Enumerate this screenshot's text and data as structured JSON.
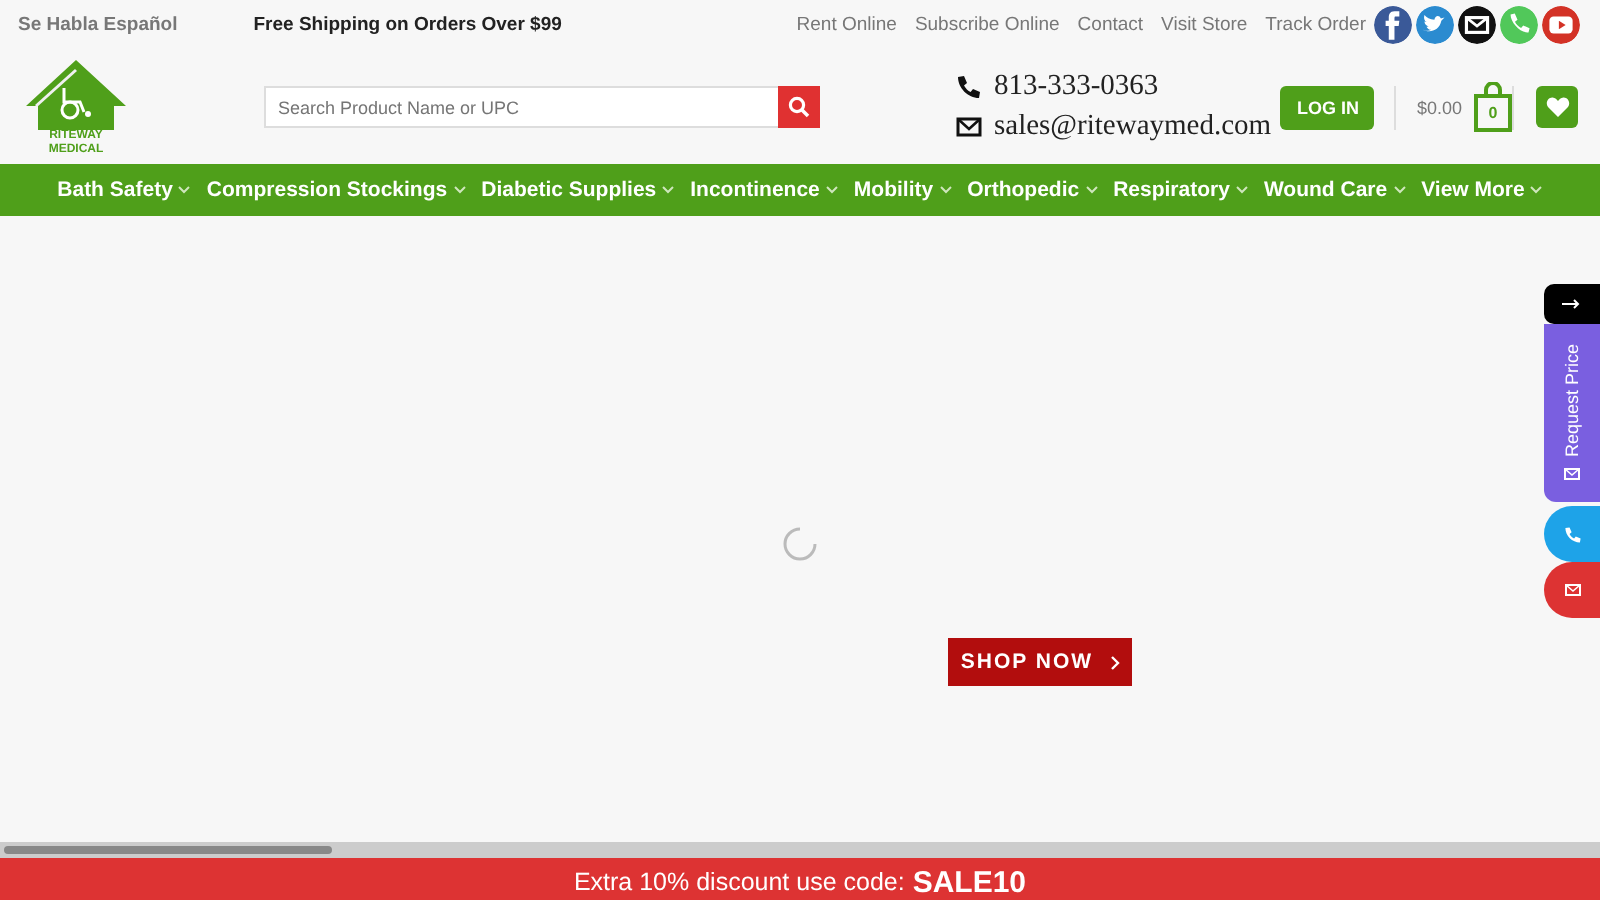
{
  "top_bar": {
    "language_note": "Se Habla Español",
    "shipping_note": "Free Shipping on Orders Over $99",
    "links": [
      "Rent Online",
      "Subscribe Online",
      "Contact",
      "Visit Store",
      "Track Order"
    ],
    "social": [
      {
        "kind": "facebook",
        "color": "#3a5998"
      },
      {
        "kind": "twitter",
        "color": "#2b8bd0"
      },
      {
        "kind": "email",
        "color": "#111111"
      },
      {
        "kind": "phone",
        "color": "#51c85a"
      },
      {
        "kind": "youtube",
        "color": "#d33226"
      }
    ]
  },
  "header": {
    "logo_text": [
      "RITEWAY",
      "MEDICAL"
    ],
    "search": {
      "placeholder": "Search Product Name or UPC"
    },
    "phone": "813-333-0363",
    "email": "sales@ritewaymed.com",
    "login": "LOG IN",
    "cart_total": "$0.00",
    "cart_count": "0"
  },
  "nav": {
    "items": [
      "Bath Safety",
      "Compression Stockings",
      "Diabetic Supplies",
      "Incontinence",
      "Mobility",
      "Orthopedic",
      "Respiratory",
      "Wound Care",
      "View More"
    ]
  },
  "hero": {
    "button": "SHOP NOW"
  },
  "side_tabs": {
    "request_price": "Request Price"
  },
  "banner": {
    "text": "Extra 10% discount use code:",
    "code": "SALE10"
  }
}
